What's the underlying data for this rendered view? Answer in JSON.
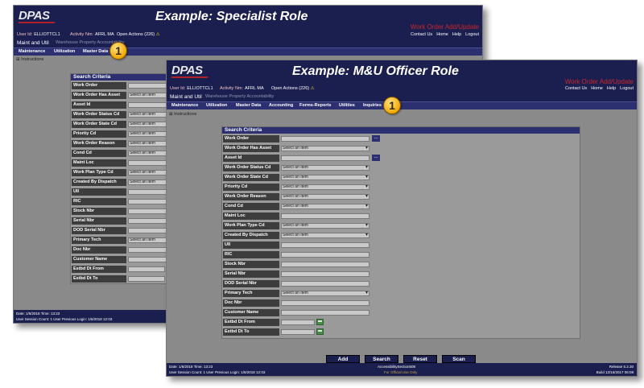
{
  "colors": {
    "header_navy": "#1b1f4f",
    "nav_blue": "#2c3071",
    "label_dark": "#3d3d3d",
    "body_gray": "#8a8a8a",
    "accent_red": "#c9262c",
    "badge_gold": "#f0a800"
  },
  "back": {
    "logo": "DPAS",
    "title": "Example: Specialist Role",
    "window_title": "Work Order Add/Update",
    "user_label": "User Id:",
    "user_id": "ELLIOTTCL1",
    "activity_label": "Activity Nm:",
    "activity": "AFRL MA",
    "open_actions": "Open Actions (226)",
    "warn_icon": "⚠",
    "links": [
      "Contact Us",
      "Home",
      "Help",
      "Logout"
    ],
    "app": "Maint and Util",
    "subapps": "Warehouse   Property Accountability",
    "nav": [
      "Maintenance",
      "Utilization",
      "Master Data"
    ],
    "instructions": "Instructions",
    "instr_icon": "⊞",
    "panel_title": "Search  Criteria",
    "select_text": "Select an Item",
    "rows": [
      "Work Order",
      "Work Order Has Asset",
      "Asset Id",
      "Work Order Status Cd",
      "Work Order State Cd",
      "Priority Cd",
      "Work Order Reason",
      "Cond Cd",
      "Maint Loc",
      "Work Plan Type Cd",
      "Created By Dispatch",
      "UII",
      "RIC",
      "Stock Nbr",
      "Serial Nbr",
      "DOD Serial Nbr",
      "Primary Tech",
      "Doc Nbr",
      "Customer Name",
      "Estbd Dt From",
      "Estbd Dt To"
    ],
    "selects": [
      "Select an Item",
      "",
      "Select an Item",
      "Select an Item",
      "Select an Item",
      "Select an Item",
      "Select an Item",
      "",
      "Select an Item",
      "Select an Item",
      "",
      "",
      "",
      "",
      "",
      "Select an Item"
    ],
    "footer": {
      "datetime": "Date: 1/6/2018 Time: 13:23",
      "session": "User Session Count: 1   User Previous Login: 1/6/2018 12:03"
    },
    "badge": "1"
  },
  "front": {
    "logo": "DPAS",
    "title": "Example: M&U Officer Role",
    "window_title": "Work Order Add/Update",
    "user_label": "User Id:",
    "user_id": "ELLIOTTCL1",
    "activity_label": "Activity Nm:",
    "activity": "AFRL MA",
    "open_actions": "Open Actions (226)",
    "warn_icon": "⚠",
    "links": [
      "Contact Us",
      "Home",
      "Help",
      "Logout"
    ],
    "app": "Maint and Util",
    "subapps": "Warehouse   Property Accountability",
    "nav": [
      "Maintenance",
      "Utilization",
      "Master Data",
      "Accounting",
      "Forms-Reports",
      "Utilities",
      "Inquiries"
    ],
    "instructions": "Instructions",
    "instr_icon": "⊞",
    "panel_title": "Search  Criteria",
    "select_text": "Select an Item",
    "lookup_label": "...",
    "rows": [
      "Work Order",
      "Work Order Has Asset",
      "Asset Id",
      "Work Order Status Cd",
      "Work Order State Cd",
      "Priority Cd",
      "Work Order Reason",
      "Cond Cd",
      "Maint Loc",
      "Work Plan Type Cd",
      "Created By Dispatch",
      "UII",
      "RIC",
      "Stock Nbr",
      "Serial Nbr",
      "DOD Serial Nbr",
      "Primary Tech",
      "Doc Nbr",
      "Customer Name",
      "Estbd Dt From",
      "Estbd Dt To"
    ],
    "buttons": [
      "Add",
      "Search",
      "Reset",
      "Scan"
    ],
    "footer": {
      "datetime": "Date: 1/6/2018 Time: 13:23",
      "session": "User Session Count: 1   User Previous Login: 1/6/2018 12:03",
      "center": "AccessibilitySection508",
      "official": "For Official Use Only",
      "release": "Release 5.2.30",
      "build": "Build 12/16/2017 06:09"
    },
    "badge": "1"
  }
}
